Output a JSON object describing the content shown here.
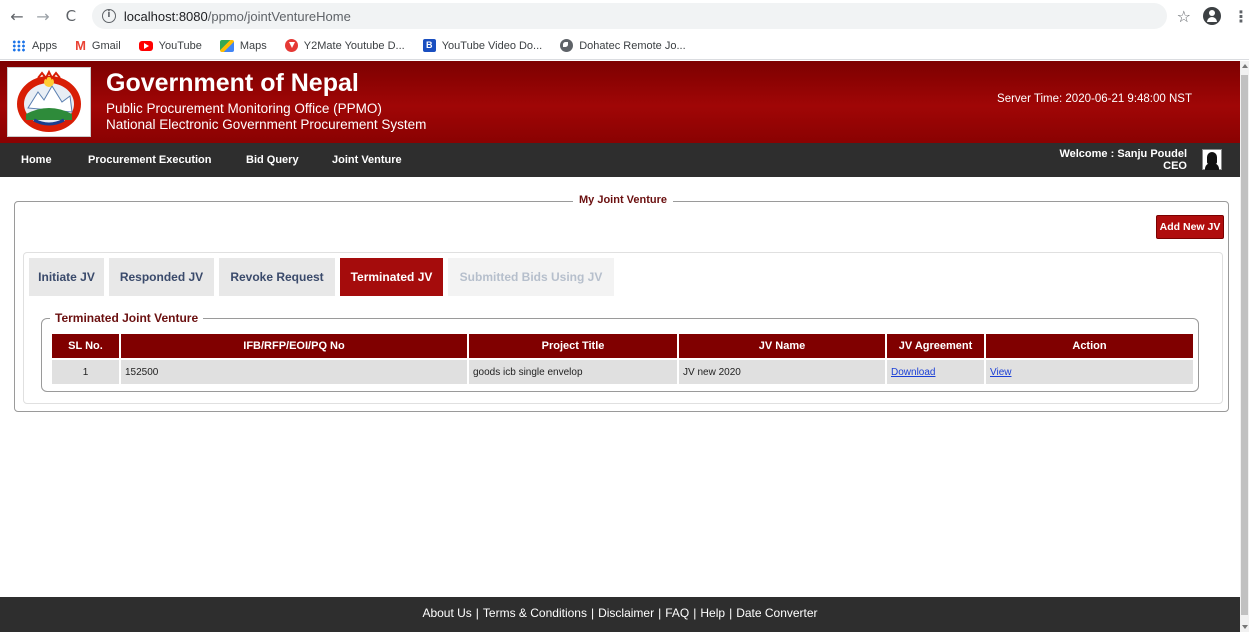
{
  "browser": {
    "url_host": "localhost:8080",
    "url_path": "/ppmo/jointVentureHome",
    "bookmarks": [
      {
        "label": "Apps",
        "icon": "apps-icon"
      },
      {
        "label": "Gmail",
        "icon": "gmail-icon"
      },
      {
        "label": "YouTube",
        "icon": "youtube-icon"
      },
      {
        "label": "Maps",
        "icon": "maps-icon"
      },
      {
        "label": "Y2Mate Youtube D...",
        "icon": "y2mate-icon"
      },
      {
        "label": "YouTube Video Do...",
        "icon": "b-icon"
      },
      {
        "label": "Dohatec Remote Jo...",
        "icon": "globe-icon"
      }
    ]
  },
  "header": {
    "title": "Government of Nepal",
    "subtitle1": "Public Procurement Monitoring Office (PPMO)",
    "subtitle2": "National Electronic Government Procurement System",
    "server_time": "Server Time: 2020-06-21 9:48:00 NST",
    "brand_color": "#9a0303"
  },
  "nav": {
    "items": [
      "Home",
      "Procurement Execution",
      "Bid Query",
      "Joint Venture"
    ],
    "welcome": "Welcome : Sanju Poudel",
    "role": "CEO"
  },
  "main": {
    "legend": "My Joint Venture",
    "add_button": "Add New JV",
    "tabs": [
      {
        "label": "Initiate JV",
        "state": "normal"
      },
      {
        "label": "Responded JV",
        "state": "normal"
      },
      {
        "label": "Revoke Request",
        "state": "normal"
      },
      {
        "label": "Terminated JV",
        "state": "active"
      },
      {
        "label": "Submitted Bids Using JV",
        "state": "disabled"
      }
    ],
    "section_legend": "Terminated Joint Venture",
    "table": {
      "headers": [
        "SL No.",
        "IFB/RFP/EOI/PQ No",
        "Project Title",
        "JV Name",
        "JV Agreement",
        "Action"
      ],
      "rows": [
        {
          "sl": "1",
          "ifb": "152500",
          "title": "goods icb single envelop",
          "jv_name": "JV new 2020",
          "agreement": "Download",
          "action": "View"
        }
      ]
    }
  },
  "footer": {
    "links": [
      "About Us",
      "Terms & Conditions",
      "Disclaimer",
      "FAQ",
      "Help",
      "Date Converter"
    ]
  }
}
